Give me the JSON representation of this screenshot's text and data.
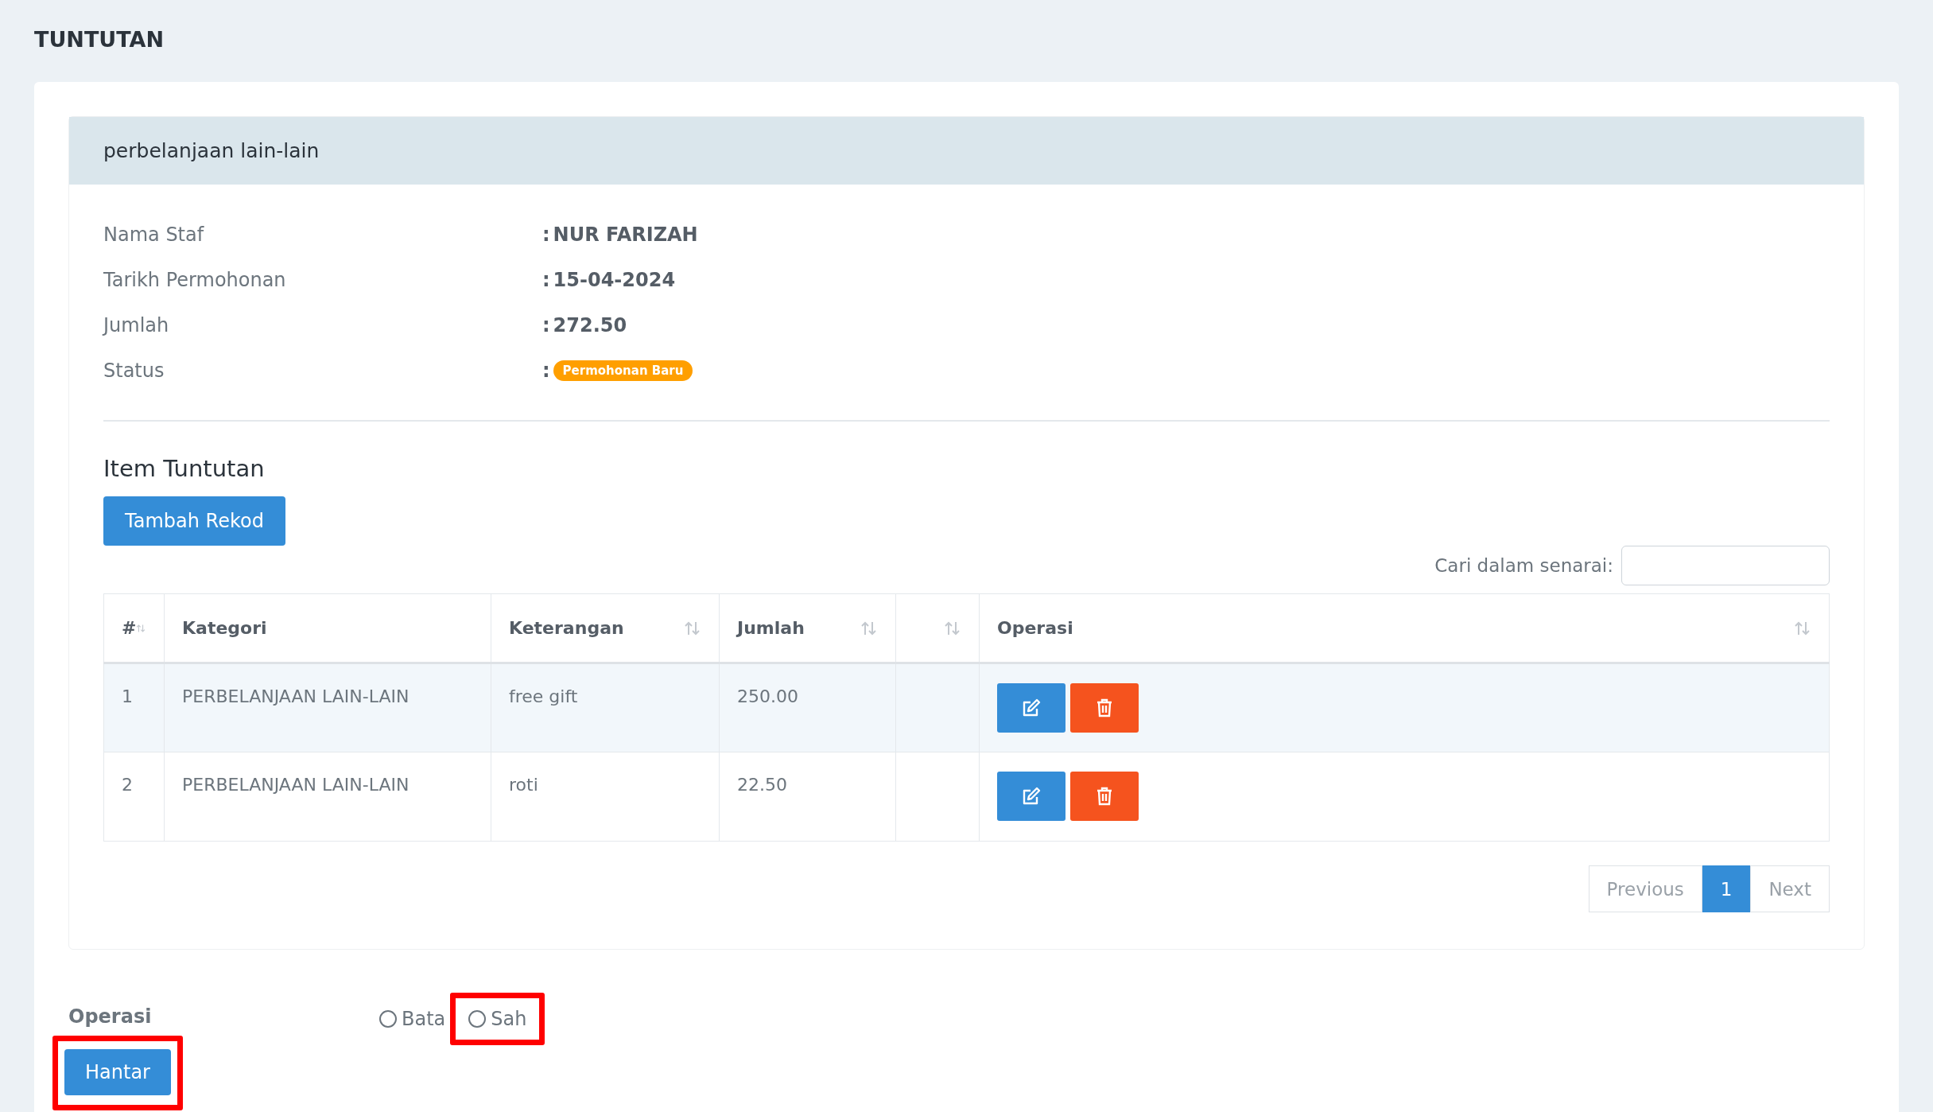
{
  "page_title": "TUNTUTAN",
  "panel": {
    "title": "perbelanjaan lain-lain",
    "details": [
      {
        "label": "Nama Staf",
        "value": "NUR FARIZAH",
        "kind": "text"
      },
      {
        "label": "Tarikh Permohonan",
        "value": "15-04-2024",
        "kind": "text"
      },
      {
        "label": "Jumlah",
        "value": "272.50",
        "kind": "text"
      },
      {
        "label": "Status",
        "value": "Permohonan Baru",
        "kind": "badge",
        "color": "#ff9f00"
      }
    ],
    "separator": ":",
    "section_title": "Item Tuntutan",
    "add_button": "Tambah Rekod",
    "search": {
      "label": "Cari dalam senarai:"
    },
    "table": {
      "columns": [
        {
          "label": "#",
          "sortable": true
        },
        {
          "label": "Kategori",
          "sortable": false
        },
        {
          "label": "Keterangan",
          "sortable": true
        },
        {
          "label": "Jumlah",
          "sortable": true
        },
        {
          "sortable": true
        },
        {
          "label": "Operasi",
          "sortable": true
        }
      ],
      "rows": [
        {
          "number": "1",
          "kategori": "PERBELANJAAN LAIN-LAIN",
          "keterangan": "free gift",
          "jumlah": "250.00",
          "striped": true
        },
        {
          "number": "2",
          "kategori": "PERBELANJAAN LAIN-LAIN",
          "keterangan": "roti",
          "jumlah": "22.50",
          "striped": false
        }
      ]
    },
    "pagination": {
      "previous": "Previous",
      "pages": [
        {
          "label": "1",
          "selected": true
        }
      ],
      "next": "Next"
    }
  },
  "operation": {
    "label": "Operasi",
    "options": [
      {
        "label": "Bata",
        "selected": false,
        "highlighted": false
      },
      {
        "label": "Sah",
        "selected": false,
        "highlighted": true
      }
    ],
    "submit": {
      "label": "Hantar",
      "highlighted": true
    }
  }
}
